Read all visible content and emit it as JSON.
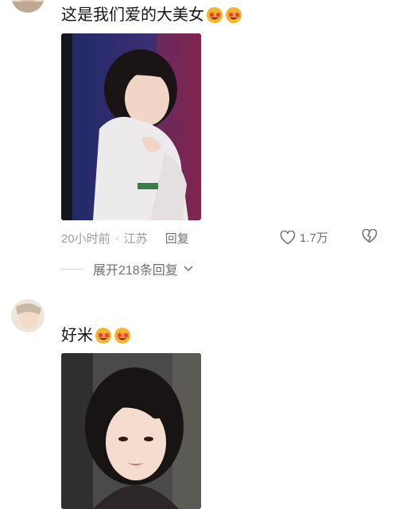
{
  "comments": [
    {
      "text": "这是我们爱的大美女",
      "emoji": [
        "star-struck-face",
        "star-struck-face"
      ],
      "time": "20小时前",
      "separator": "·",
      "location": "江苏",
      "reply_label": "回复",
      "likes": "1.7万",
      "expand_label": "展开218条回复"
    },
    {
      "text": "好米",
      "emoji": [
        "star-struck-face",
        "star-struck-face"
      ]
    }
  ],
  "colors": {
    "text": "#161616",
    "meta": "#9a9a9a",
    "action": "#6f6f6f",
    "emoji": "#f5b62a"
  }
}
